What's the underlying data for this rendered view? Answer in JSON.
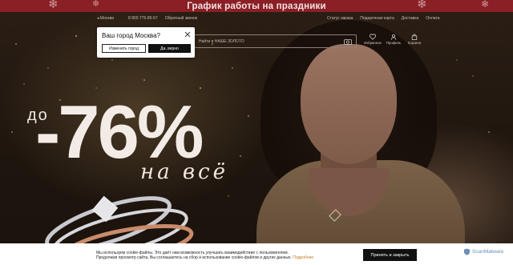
{
  "banner": {
    "title": "График работы на праздники"
  },
  "header": {
    "city": "Москва",
    "phone": "8 800 775-85-57",
    "feedback": "Обратный звонок",
    "links": [
      "Статус заказа",
      "Подарочная карта",
      "Доставка",
      "Оплата"
    ],
    "search_placeholder": "Найти в НАШЕ ЗОЛОТО",
    "icons": [
      {
        "label": "Избранное",
        "icon": "heart-icon"
      },
      {
        "label": "Профиль",
        "icon": "user-icon"
      },
      {
        "label": "Корзина",
        "icon": "bag-icon"
      }
    ]
  },
  "city_popup": {
    "question": "Ваш город Москва?",
    "change_label": "Изменить город",
    "confirm_label": "Да, верно"
  },
  "promo": {
    "prefix": "до",
    "discount": "-76%",
    "subtitle": "на всё"
  },
  "cookie": {
    "line1": "Мы используем cookie-файлы. Это даёт нам возможность улучшать взаимодействие с пользователем.",
    "line2": "Продолжая просмотр сайта, Вы соглашаетесь на сбор и использование cookie-файлов и других данных.",
    "more_link": "Подробнее",
    "accept_label": "Принять и закрыть"
  },
  "badge": {
    "label": "ScanMalware"
  },
  "colors": {
    "banner_bg": "#8a1f25",
    "accent_link": "#c07a1a",
    "button_dark": "#111111"
  }
}
